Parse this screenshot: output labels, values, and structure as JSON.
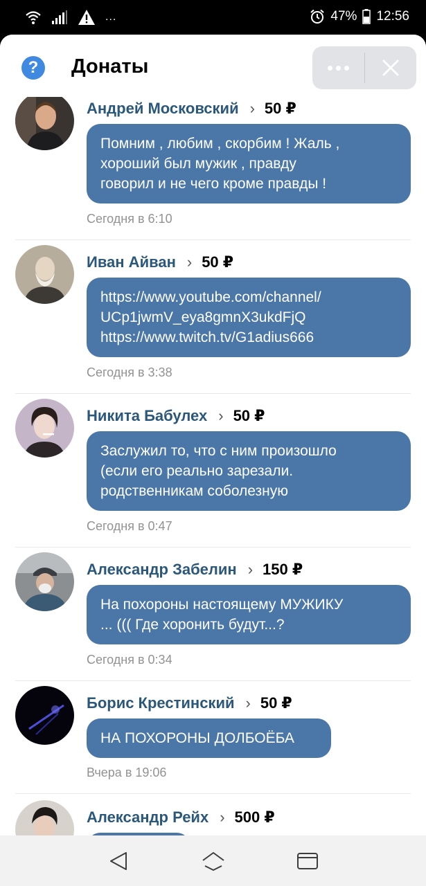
{
  "status_bar": {
    "battery": "47%",
    "time": "12:56",
    "dots": "..."
  },
  "header": {
    "title": "Донаты",
    "help_icon": "help-circle-icon",
    "more_icon": "more-dots-icon",
    "close_icon": "close-icon"
  },
  "colors": {
    "accent": "#3f8ae0",
    "bubble": "#4a76a8",
    "name": "#2b587a",
    "date": "#929292"
  },
  "donations": [
    {
      "name": "Андрей Московский",
      "amount": "50 ₽",
      "message": "Помним , любим , скорбим ! Жаль ,\nхороший был мужик , правду\nговорил и не чего кроме правды !",
      "date": "Сегодня в 6:10"
    },
    {
      "name": "Иван Айван",
      "amount": "50 ₽",
      "message": "https://www.youtube.com/channel/\nUCp1jwmV_eya8gmnX3ukdFjQ\nhttps://www.twitch.tv/G1adius666",
      "date": "Сегодня в 3:38"
    },
    {
      "name": "Никита Бабулех",
      "amount": "50 ₽",
      "message": "Заслужил то, что с ним произошло\n(если его реально зарезали.\nродственникам соболезную",
      "date": "Сегодня в 0:47"
    },
    {
      "name": "Александр Забелин",
      "amount": "150 ₽",
      "message": "На похороны настоящему МУЖИКУ\n... ((( Где хоронить будут...?",
      "date": "Сегодня в 0:34"
    },
    {
      "name": "Борис Крестинский",
      "amount": "50 ₽",
      "message": "НА ПОХОРОНЫ ДОЛБОЁБА",
      "date": "Вчера в 19:06"
    },
    {
      "name": "Александр Рейх",
      "amount": "500 ₽",
      "message": "",
      "date": ""
    }
  ],
  "nav": {
    "back_icon": "back-triangle-icon",
    "home_icon": "home-icon",
    "recents_icon": "recents-icon"
  }
}
